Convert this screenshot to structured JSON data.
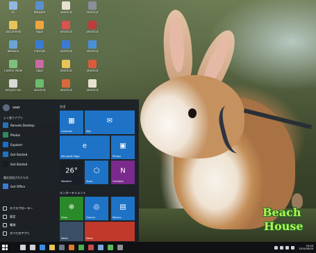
{
  "desktop_icons": [
    {
      "name": "PC",
      "color": "#8fb8e0"
    },
    {
      "name": "Documents",
      "color": "#e8c35a"
    },
    {
      "name": "Network",
      "color": "#6aa5d8"
    },
    {
      "name": "Control Panel",
      "color": "#7ec07a"
    },
    {
      "name": "Recycle Bin",
      "color": "#d8d8d8"
    },
    {
      "name": "Network",
      "color": "#5b8fd0"
    },
    {
      "name": "Apps",
      "color": "#f0a640"
    },
    {
      "name": "Internet",
      "color": "#3a7bd5"
    },
    {
      "name": "Apps",
      "color": "#c86aa5"
    },
    {
      "name": "Shortcut",
      "color": "#6dbb6d"
    },
    {
      "name": "Shortcut",
      "color": "#e6e0d0"
    },
    {
      "name": "Shortcut",
      "color": "#d9534f"
    },
    {
      "name": "Shortcut",
      "color": "#3a7bd5"
    },
    {
      "name": "Shortcut",
      "color": "#e8c35a"
    },
    {
      "name": "Shortcut",
      "color": "#d86a3a"
    },
    {
      "name": "Shortcut",
      "color": "#8a8f99"
    },
    {
      "name": "Shortcut",
      "color": "#c23b3b"
    },
    {
      "name": "Shortcut",
      "color": "#4a90d9"
    },
    {
      "name": "Shortcut",
      "color": "#d95b3a"
    },
    {
      "name": "Shortcut",
      "color": "#e6e0d0"
    }
  ],
  "start_menu": {
    "user_name": "user",
    "section_most_used": "よく使うアプリ",
    "apps": [
      {
        "label": "Remote Desktop",
        "color": "#2c6fb8"
      },
      {
        "label": "Photos",
        "color": "#2e8b57"
      },
      {
        "label": "Explorer",
        "color": "#1a6fc4"
      },
      {
        "label": "Get Started",
        "color": "#1e73be"
      },
      {
        "label": "Get Started",
        "color": "#1a1a1a"
      }
    ],
    "section_recent": "最近追加されたもの",
    "recent_app": {
      "label": "Get Office",
      "color": "#3a7bd5"
    },
    "bottom": [
      {
        "label": "エクスプローラー",
        "icon": "folder-icon"
      },
      {
        "label": "設定",
        "icon": "gear-icon"
      },
      {
        "label": "電源",
        "icon": "power-icon"
      },
      {
        "label": "すべてのアプリ",
        "icon": "list-icon"
      }
    ],
    "group_life": "生活",
    "group_play": "エンターテイメント",
    "tiles": [
      {
        "label": "Calendar",
        "glyph": "▦",
        "color": "#1e73c7"
      },
      {
        "label": "Mail",
        "glyph": "✉",
        "color": "#1e73c7"
      },
      {
        "label": "Microsoft Edge",
        "glyph": "e",
        "color": "#1e73c7"
      },
      {
        "label": "Photos",
        "glyph": "▣",
        "color": "#1e73c7"
      },
      {
        "label": "Weather",
        "glyph": "26°",
        "color": "#1a1e26"
      },
      {
        "label": "Store",
        "glyph": "⬡",
        "color": "#1e73c7"
      },
      {
        "label": "OneNote",
        "glyph": "N",
        "color": "#7a2a8c"
      },
      {
        "label": "Xbox",
        "glyph": "⊗",
        "color": "#2a8a2a"
      },
      {
        "label": "Groove",
        "glyph": "◎",
        "color": "#1e73c7"
      },
      {
        "label": "Movies",
        "glyph": "▤",
        "color": "#1e73c7"
      },
      {
        "label": "News",
        "glyph": "",
        "color": "#3a4f66"
      },
      {
        "label": "News",
        "glyph": "",
        "color": "#c0392b"
      }
    ]
  },
  "logo": {
    "line1": "Beach",
    "line2": "House"
  },
  "taskbar": {
    "apps": [
      {
        "icon": "search-icon",
        "color": "#d0d4d9"
      },
      {
        "icon": "task-view-icon",
        "color": "#d0d4d9"
      },
      {
        "icon": "edge-icon",
        "color": "#3a8ee6"
      },
      {
        "icon": "explorer-icon",
        "color": "#e8c35a"
      },
      {
        "icon": "store-icon",
        "color": "#6c7a8a"
      },
      {
        "icon": "firefox-icon",
        "color": "#e07a2e"
      },
      {
        "icon": "chrome-icon",
        "color": "#4caf50"
      },
      {
        "icon": "app-icon",
        "color": "#c94c4c"
      },
      {
        "icon": "photo-icon",
        "color": "#7aa6d8"
      },
      {
        "icon": "app-icon",
        "color": "#5cb85c"
      },
      {
        "icon": "app-icon",
        "color": "#8e8e8e"
      }
    ],
    "time": "20:00",
    "date": "2015/09/20"
  }
}
